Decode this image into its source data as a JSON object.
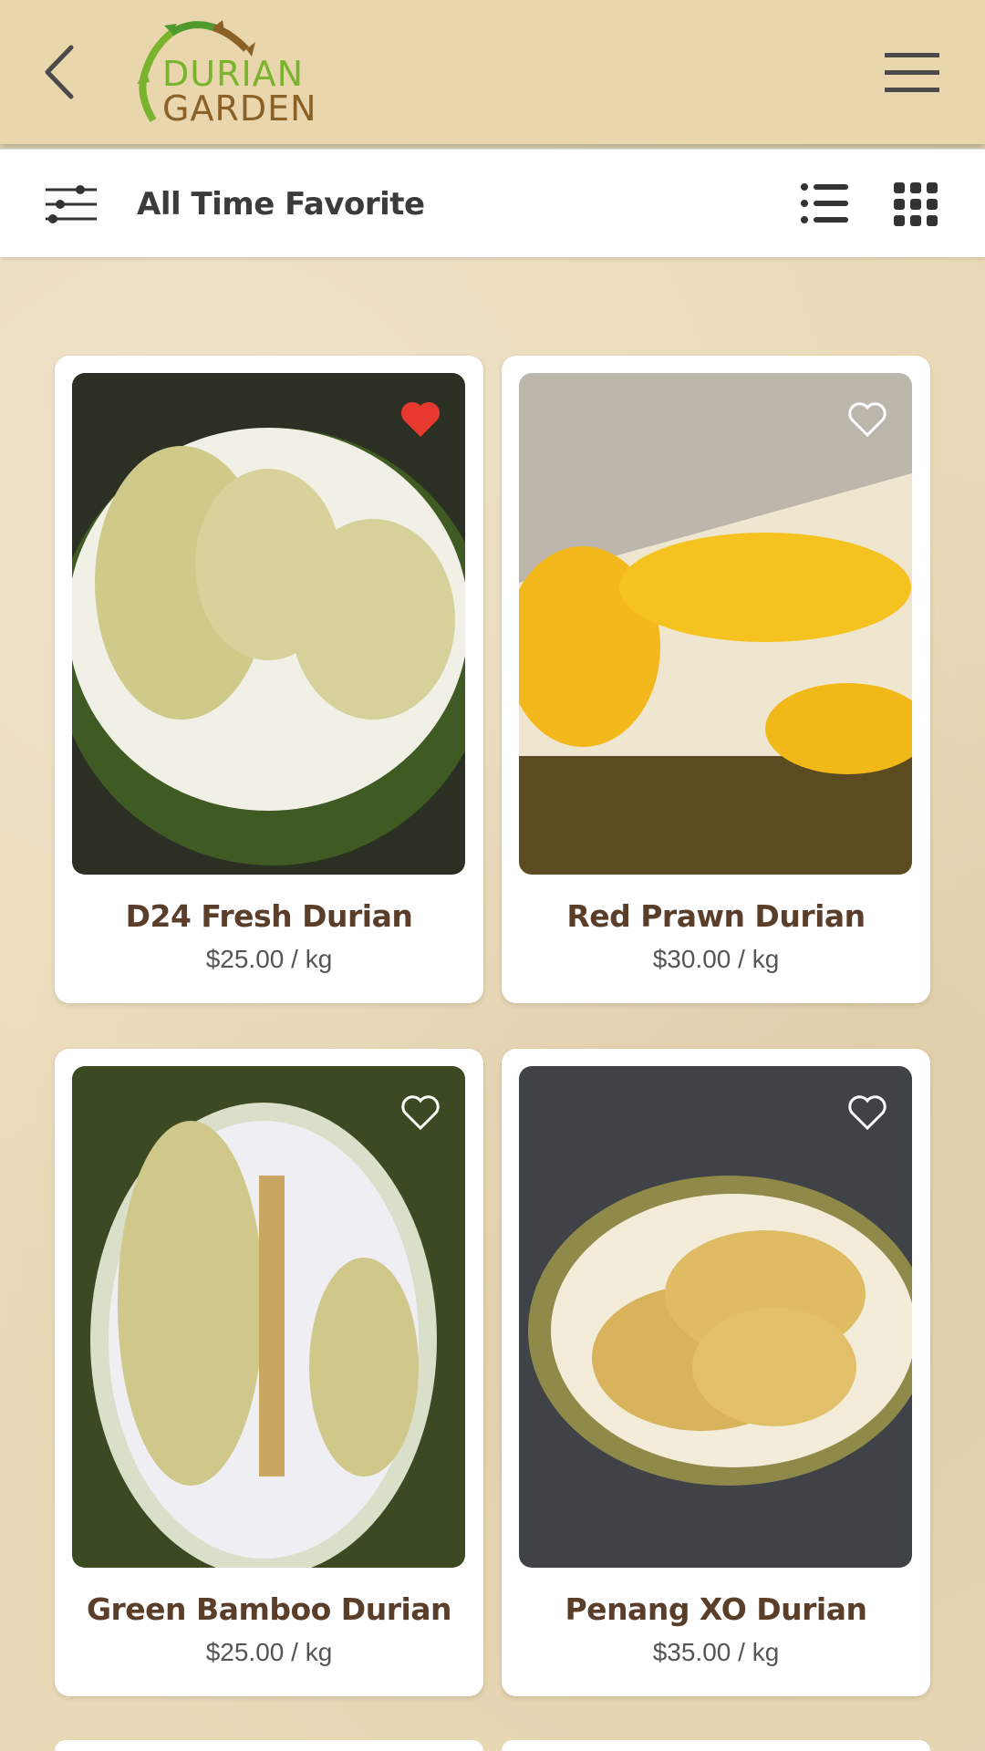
{
  "header": {
    "logo_line1": "DURIAN",
    "logo_line2": "GARDEN",
    "back_icon": "chevron-left-icon",
    "menu_icon": "hamburger-icon"
  },
  "toolbar": {
    "title": "All Time Favorite",
    "filter_icon": "sliders-icon",
    "list_icon": "list-view-icon",
    "grid_icon": "grid-view-icon"
  },
  "products": [
    {
      "name": "D24 Fresh Durian",
      "price": "$25.00 / kg",
      "favorite": true
    },
    {
      "name": "Red Prawn Durian",
      "price": "$30.00 / kg",
      "favorite": false
    },
    {
      "name": "Green Bamboo Durian",
      "price": "$25.00 / kg",
      "favorite": false
    },
    {
      "name": "Penang XO Durian",
      "price": "$35.00 / kg",
      "favorite": false
    }
  ],
  "colors": {
    "background": "#ead9b6",
    "header": "#e9d6ad",
    "heart_active": "#e8392f",
    "title_text": "#5a3e2a",
    "logo_green": "#7ab42f",
    "logo_brown": "#8a6126"
  }
}
